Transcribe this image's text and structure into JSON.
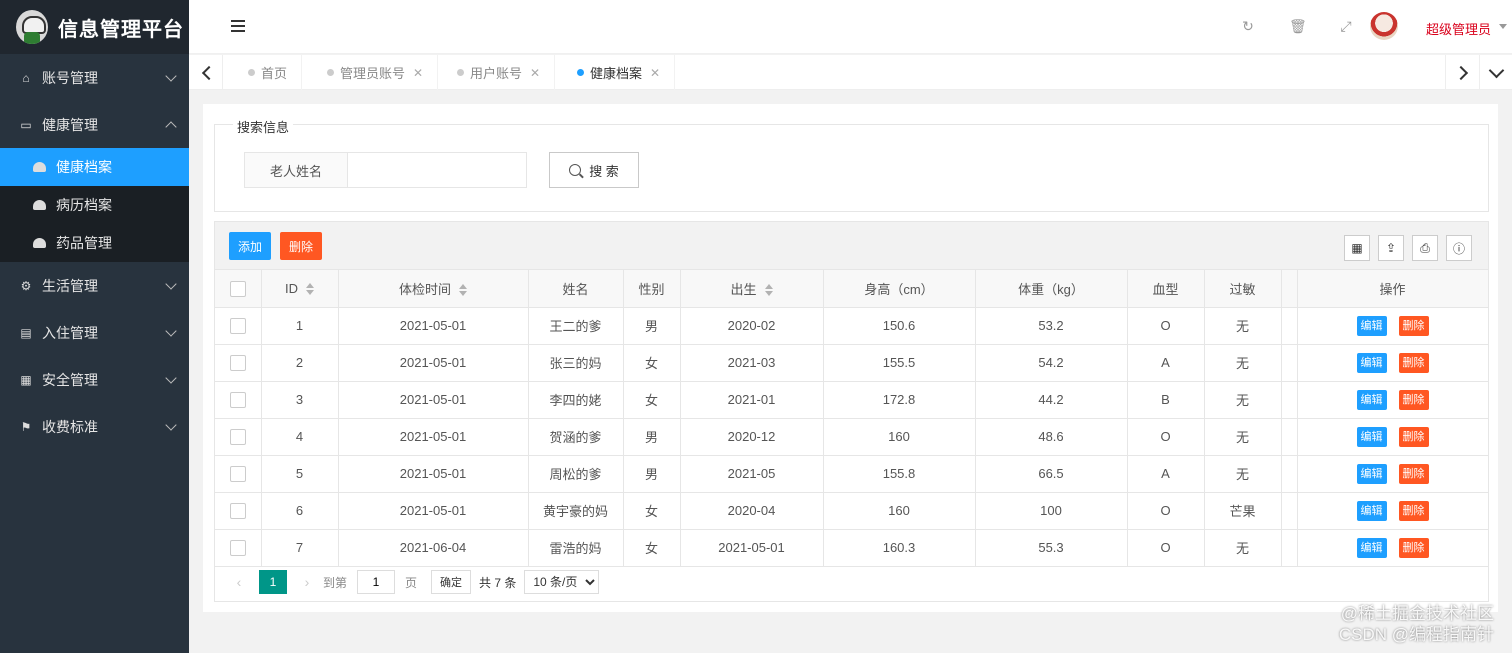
{
  "app": {
    "title": "信息管理平台"
  },
  "sidebar": {
    "items": [
      {
        "label": "账号管理",
        "icon": "home-icon",
        "expanded": false
      },
      {
        "label": "健康管理",
        "icon": "window-icon",
        "expanded": true,
        "children": [
          {
            "label": "健康档案",
            "active": true
          },
          {
            "label": "病历档案",
            "active": false
          },
          {
            "label": "药品管理",
            "active": false
          }
        ]
      },
      {
        "label": "生活管理",
        "icon": "gears-icon",
        "expanded": false
      },
      {
        "label": "入住管理",
        "icon": "file-icon",
        "expanded": false
      },
      {
        "label": "安全管理",
        "icon": "calendar-icon",
        "expanded": false
      },
      {
        "label": "收费标准",
        "icon": "flag-icon",
        "expanded": false
      }
    ]
  },
  "header": {
    "user_name": "超级管理员"
  },
  "tabs": [
    {
      "label": "首页",
      "active": false,
      "closable": false
    },
    {
      "label": "管理员账号",
      "active": false,
      "closable": true
    },
    {
      "label": "用户账号",
      "active": false,
      "closable": true
    },
    {
      "label": "健康档案",
      "active": true,
      "closable": true
    }
  ],
  "search": {
    "legend": "搜索信息",
    "field_label": "老人姓名",
    "value": "",
    "placeholder": "",
    "button_label": "搜 索"
  },
  "toolbar": {
    "add_label": "添加",
    "delete_label": "删除"
  },
  "table": {
    "columns": [
      "ID",
      "体检时间",
      "姓名",
      "性别",
      "出生",
      "身高（cm）",
      "体重（kg）",
      "血型",
      "过敏",
      "操作"
    ],
    "rows": [
      {
        "id": "1",
        "date": "2021-05-01",
        "name": "王二的爹",
        "sex": "男",
        "birth": "2020-02",
        "height": "150.6",
        "weight": "53.2",
        "blood": "O",
        "allergy": "无"
      },
      {
        "id": "2",
        "date": "2021-05-01",
        "name": "张三的妈",
        "sex": "女",
        "birth": "2021-03",
        "height": "155.5",
        "weight": "54.2",
        "blood": "A",
        "allergy": "无"
      },
      {
        "id": "3",
        "date": "2021-05-01",
        "name": "李四的姥",
        "sex": "女",
        "birth": "2021-01",
        "height": "172.8",
        "weight": "44.2",
        "blood": "B",
        "allergy": "无"
      },
      {
        "id": "4",
        "date": "2021-05-01",
        "name": "贺涵的爹",
        "sex": "男",
        "birth": "2020-12",
        "height": "160",
        "weight": "48.6",
        "blood": "O",
        "allergy": "无"
      },
      {
        "id": "5",
        "date": "2021-05-01",
        "name": "周松的爹",
        "sex": "男",
        "birth": "2021-05",
        "height": "155.8",
        "weight": "66.5",
        "blood": "A",
        "allergy": "无"
      },
      {
        "id": "6",
        "date": "2021-05-01",
        "name": "黄宇豪的妈",
        "sex": "女",
        "birth": "2020-04",
        "height": "160",
        "weight": "100",
        "blood": "O",
        "allergy": "芒果"
      },
      {
        "id": "7",
        "date": "2021-06-04",
        "name": "雷浩的妈",
        "sex": "女",
        "birth": "2021-05-01",
        "height": "160.3",
        "weight": "55.3",
        "blood": "O",
        "allergy": "无"
      }
    ],
    "edit_label": "编辑",
    "delete_label": "删除"
  },
  "pager": {
    "current_page": "1",
    "goto_prefix": "到第",
    "goto_value": "1",
    "goto_suffix": "页",
    "confirm_label": "确定",
    "total_text": "共 7 条",
    "page_size": "10 条/页"
  },
  "watermark": {
    "line1": "@稀土掘金技术社区",
    "line2": "CSDN @编程指南针"
  },
  "colors": {
    "primary": "#1e9fff",
    "danger": "#ff5722",
    "pager_active": "#009688",
    "sidebar_bg": "#28333e"
  }
}
